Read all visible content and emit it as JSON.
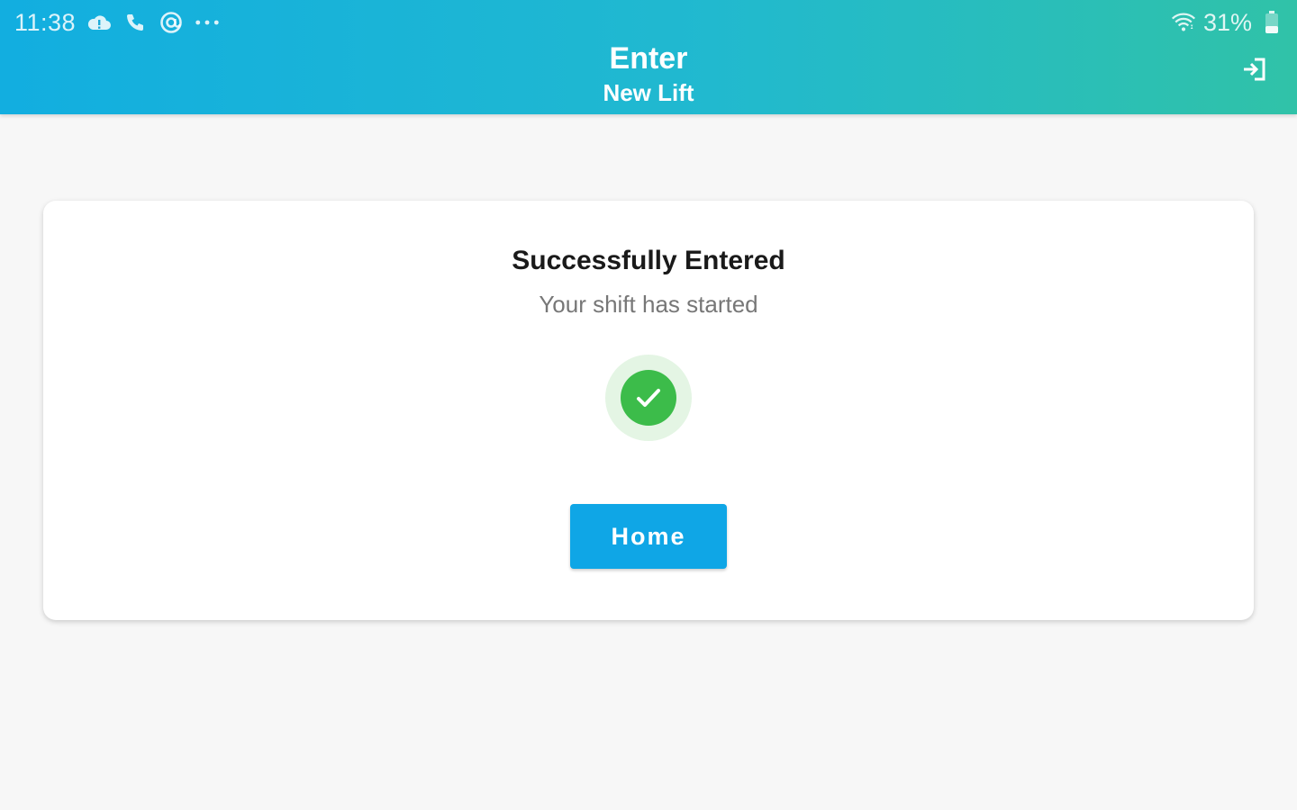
{
  "status_bar": {
    "time": "11:38",
    "left_icons": [
      "cloud-alert-icon",
      "phone-icon",
      "at-sign-icon",
      "more-dots-icon"
    ],
    "battery_percent": "31%",
    "right_icons": [
      "wifi-icon",
      "battery-icon"
    ]
  },
  "app_bar": {
    "title": "Enter",
    "subtitle": "New Lift",
    "action_icon": "logout-icon"
  },
  "card": {
    "title": "Successfully Entered",
    "message": "Your shift has started",
    "status_icon": "check-circle-icon",
    "button_label": "Home"
  },
  "colors": {
    "appbar_gradient_start": "#12aee0",
    "appbar_gradient_end": "#30c2a8",
    "success_green": "#3cbc4a",
    "button_blue": "#0fa6e6",
    "background": "#f7f7f7"
  }
}
